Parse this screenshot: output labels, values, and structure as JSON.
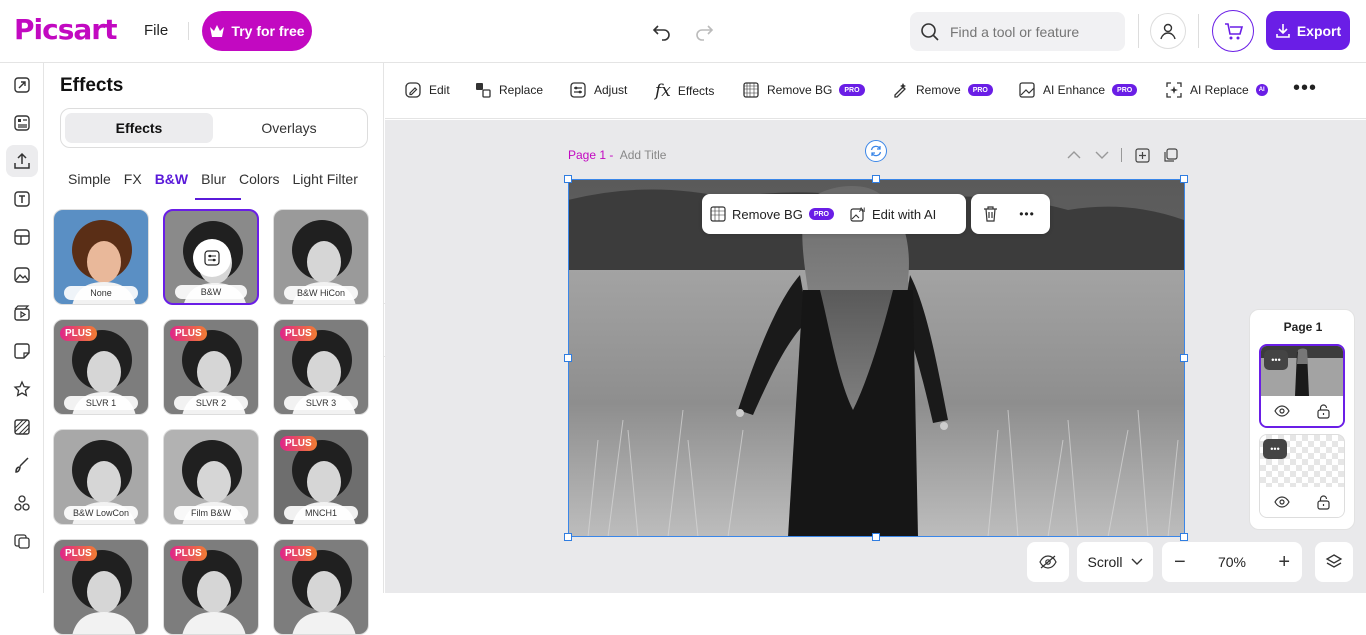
{
  "app": {
    "logo": "Picsart",
    "file_menu": "File",
    "try_free": "Try for free",
    "search_placeholder": "Find a tool or feature",
    "export": "Export"
  },
  "panel": {
    "title": "Effects",
    "segments": [
      "Effects",
      "Overlays"
    ],
    "subtabs": [
      "Simple",
      "FX",
      "B&W",
      "Blur",
      "Colors",
      "Light Filter"
    ],
    "active_subtab": "B&W",
    "thumbs": [
      {
        "label": "None",
        "badge": ""
      },
      {
        "label": "B&W",
        "badge": ""
      },
      {
        "label": "B&W HiCon",
        "badge": ""
      },
      {
        "label": "SLVR 1",
        "badge": "PLUS"
      },
      {
        "label": "SLVR 2",
        "badge": "PLUS"
      },
      {
        "label": "SLVR 3",
        "badge": "PLUS"
      },
      {
        "label": "B&W LowCon",
        "badge": ""
      },
      {
        "label": "Film B&W",
        "badge": ""
      },
      {
        "label": "MNCH1",
        "badge": "PLUS"
      },
      {
        "label": "",
        "badge": "PLUS"
      },
      {
        "label": "",
        "badge": "PLUS"
      },
      {
        "label": "",
        "badge": "PLUS"
      }
    ]
  },
  "toolbar": {
    "edit": "Edit",
    "replace": "Replace",
    "adjust": "Adjust",
    "effects": "Effects",
    "remove_bg": "Remove BG",
    "remove": "Remove",
    "ai_enhance": "AI Enhance",
    "ai_replace": "AI Replace",
    "pro": "PRO",
    "ai": "AI"
  },
  "canvas": {
    "page_label": "Page 1 -",
    "add_title": "Add Title",
    "ctx_remove_bg": "Remove BG",
    "ctx_pro": "PRO",
    "ctx_edit_ai": "Edit with AI"
  },
  "pages": {
    "title": "Page 1"
  },
  "bottom": {
    "scroll": "Scroll",
    "zoom": "70%"
  },
  "colors": {
    "brand": "#c209c1",
    "accent": "#6a1ee6",
    "selection": "#3a86e8"
  }
}
